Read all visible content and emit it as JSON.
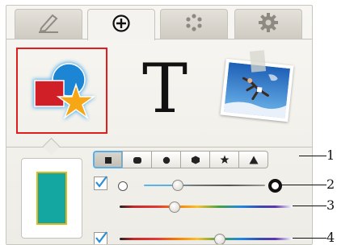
{
  "tabs": [
    {
      "icon": "pencil-icon",
      "active": false
    },
    {
      "icon": "add-circle-icon",
      "active": true
    },
    {
      "icon": "dots-icon",
      "active": false
    },
    {
      "icon": "gear-icon",
      "active": false
    }
  ],
  "tools": {
    "shapes_icon": "shapes-icon",
    "text_label": "T",
    "photo_icon": "photo-icon",
    "selected": "shapes"
  },
  "preview": {
    "fill": "#14a6a0",
    "stroke": "#e0b918"
  },
  "shape_options": [
    "square",
    "rounded-rectangle",
    "circle",
    "hexagon",
    "star",
    "triangle"
  ],
  "selected_shape": "square",
  "controls": {
    "row_stroke": {
      "checked": true,
      "thin_icon": "thin-stroke-circle-icon",
      "thick_icon": "thick-stroke-circle-icon",
      "slider_value": 0.28
    },
    "row_color": {
      "slider_value": 0.32
    },
    "row_fill": {
      "checked": true,
      "slider_value": 0.58
    }
  },
  "callouts": [
    "1",
    "2",
    "3",
    "4"
  ],
  "colors": {
    "accent": "#5ab0e6",
    "selection": "#e11d1d",
    "check": "#2a8fd6"
  }
}
